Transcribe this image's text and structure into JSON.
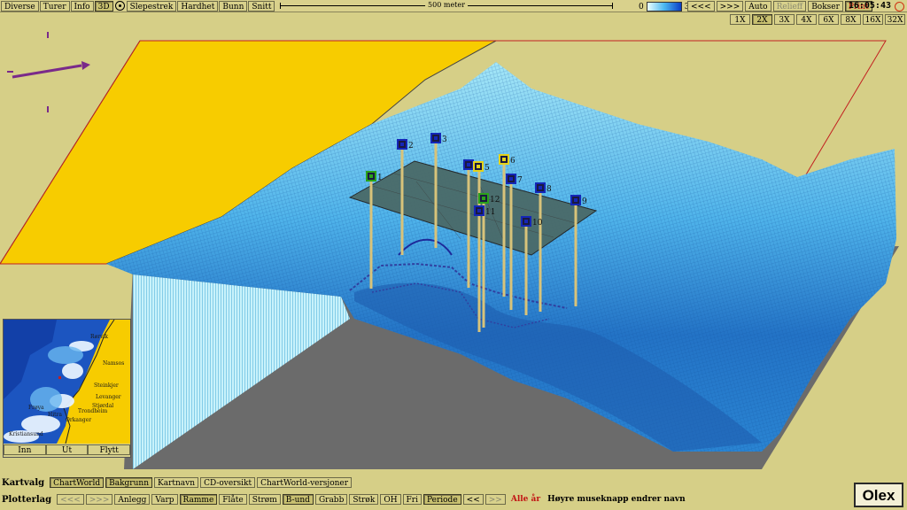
{
  "menu": [
    "Diverse",
    "Turer",
    "Info",
    "3D",
    "Slepestrek",
    "Hardhet",
    "Bunn",
    "Snitt"
  ],
  "scale_label": "500 meter",
  "depth_legend": {
    "min": "0",
    "max": "300"
  },
  "nav": {
    "prev": "<<<",
    "next": ">>>",
    "auto": "Auto"
  },
  "right_buttons": {
    "relieff": "Relieff",
    "bokser": "Bokser",
    "print": "Print"
  },
  "clock": "16:05:43",
  "zoom": [
    "1X",
    "2X",
    "3X",
    "4X",
    "6X",
    "8X",
    "16X",
    "32X"
  ],
  "zoom_active": "2X",
  "markers": [
    {
      "n": "1",
      "color": "#2ba21a"
    },
    {
      "n": "2",
      "color": "#1426b8"
    },
    {
      "n": "3",
      "color": "#1426b8"
    },
    {
      "n": "4",
      "color": "#1426b8"
    },
    {
      "n": "5",
      "color": "#e4d21a"
    },
    {
      "n": "6",
      "color": "#e4d21a"
    },
    {
      "n": "7",
      "color": "#1426b8"
    },
    {
      "n": "8",
      "color": "#1426b8"
    },
    {
      "n": "9",
      "color": "#1426b8"
    },
    {
      "n": "10",
      "color": "#1426b8"
    },
    {
      "n": "11",
      "color": "#1426b8"
    },
    {
      "n": "12",
      "color": "#2ba21a"
    }
  ],
  "minimap": {
    "places": [
      "Rørvik",
      "Namsos",
      "Steinkjer",
      "Levanger",
      "Stjørdal",
      "Trondheim",
      "Orkanger",
      "Hitra",
      "Frøya",
      "Kristiansund"
    ],
    "buttons": [
      "Inn",
      "Ut",
      "Flytt"
    ]
  },
  "kartvalg": {
    "label": "Kartvalg",
    "buttons": [
      "ChartWorld",
      "Bakgrunn",
      "Kartnavn",
      "CD-oversikt",
      "ChartWorld-versjoner"
    ],
    "active": [
      "ChartWorld",
      "Bakgrunn"
    ]
  },
  "plotterlag": {
    "label": "Plotterlag",
    "buttons": [
      "<<<",
      ">>>",
      "Anlegg",
      "Varp",
      "Ramme",
      "Flåte",
      "Strøm",
      "B-und",
      "Grabb",
      "Strøk",
      "OH",
      "Fri",
      "Periode",
      "<<",
      ">>"
    ],
    "active": [
      "Ramme",
      "B-und",
      "Periode"
    ],
    "dim": [
      "<<<",
      ">>>",
      ">>"
    ],
    "alle_aar": "Alle år",
    "hint": "Høyre museknapp endrer navn"
  },
  "logo": "Olex",
  "colors": {
    "land": "#f7cc00",
    "sea_light": "#9fe2f5",
    "sea_dark": "#1f5fb0",
    "frame": "#c22020",
    "platform": "#4a6a68",
    "track": "#3040a0",
    "compass": "#7a2a8a"
  }
}
